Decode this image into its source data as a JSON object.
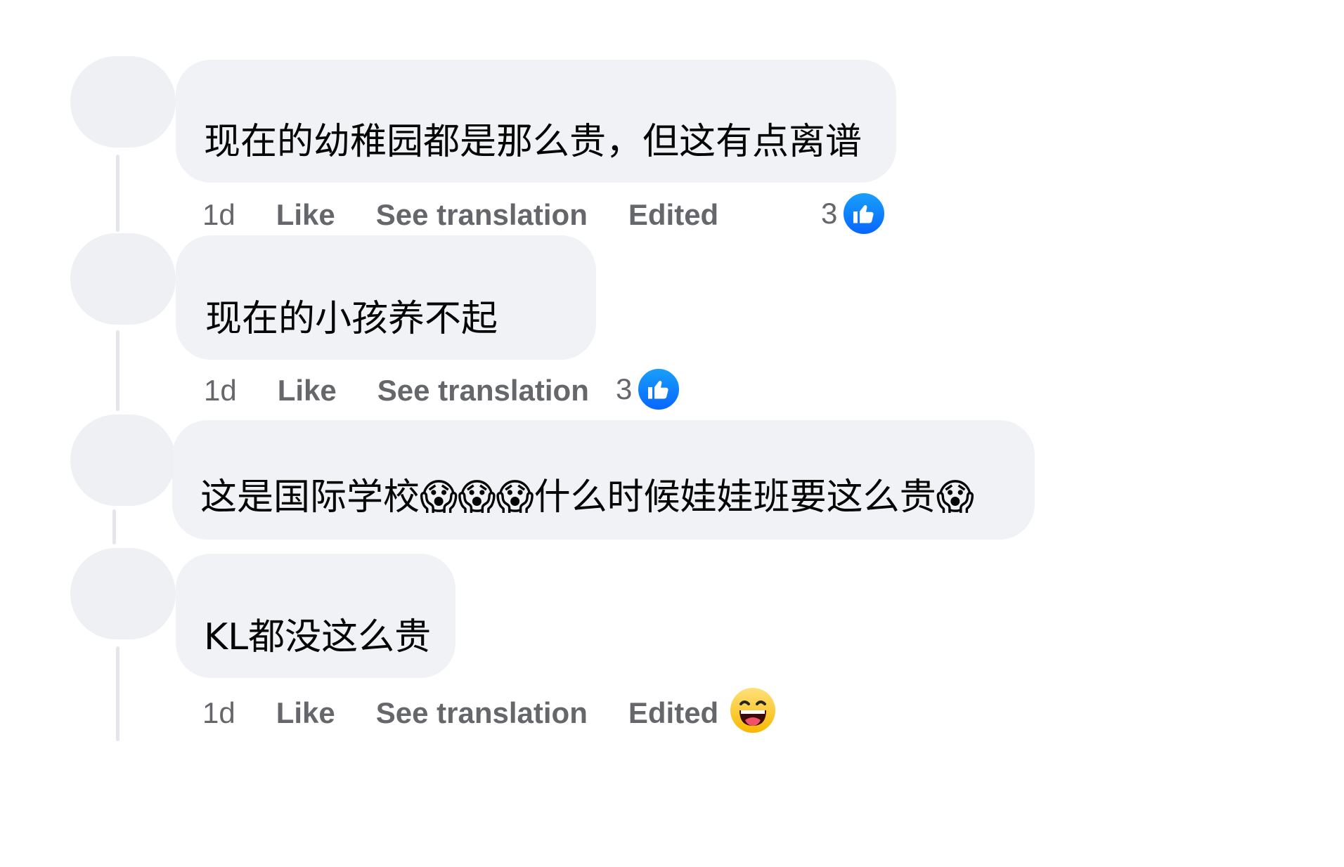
{
  "comments": [
    {
      "text": "现在的幼稚园都是那么贵，但这有点离谱",
      "time": "1d",
      "like_label": "Like",
      "translate_label": "See translation",
      "edited_label": "Edited",
      "reaction_count": "3",
      "reaction_icon": "like-icon"
    },
    {
      "text": "现在的小孩养不起",
      "time": "1d",
      "like_label": "Like",
      "translate_label": "See translation",
      "reaction_count": "3",
      "reaction_icon": "like-icon"
    },
    {
      "text_prefix": "这是国际学校",
      "emoji": "😱",
      "text_middle": "什么时候娃娃班要这么贵",
      "emoji_trailing": "😱"
    },
    {
      "text": "KL都没这么贵",
      "time": "1d",
      "like_label": "Like",
      "translate_label": "See translation",
      "edited_label": "Edited",
      "reaction_icon": "haha-icon"
    }
  ],
  "colors": {
    "bubble": "#f0f2f5",
    "meta_text": "#65676b",
    "like_blue": "#0866ff",
    "body_text": "#050505"
  }
}
